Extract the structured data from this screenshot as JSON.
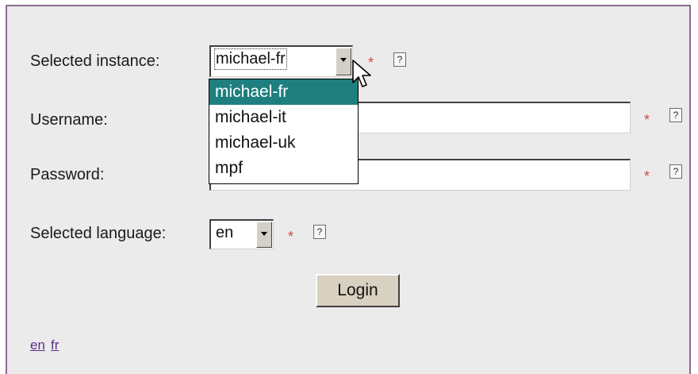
{
  "form": {
    "instance": {
      "label": "Selected instance:",
      "value": "michael-fr",
      "required_mark": "*",
      "help_glyph": "?",
      "options": [
        "michael-fr",
        "michael-it",
        "michael-uk",
        "mpf"
      ],
      "selected_index": 0
    },
    "username": {
      "label": "Username:",
      "value": "",
      "required_mark": "*",
      "help_glyph": "?"
    },
    "password": {
      "label": "Password:",
      "value": "",
      "required_mark": "*",
      "help_glyph": "?"
    },
    "language": {
      "label": "Selected language:",
      "value": "en",
      "required_mark": "*",
      "help_glyph": "?"
    },
    "login_label": "Login"
  },
  "footer": {
    "links": [
      "en",
      "fr"
    ]
  },
  "colors": {
    "panel_border": "#8a6a8c",
    "panel_bg": "#ebebeb",
    "highlight": "#1f7f7f",
    "required": "#d04a4a",
    "link": "#5a2f8a"
  },
  "icons": {
    "cursor": "arrow-cursor-icon",
    "dropdown_arrow": "chevron-down-icon",
    "help": "question-mark-icon"
  }
}
